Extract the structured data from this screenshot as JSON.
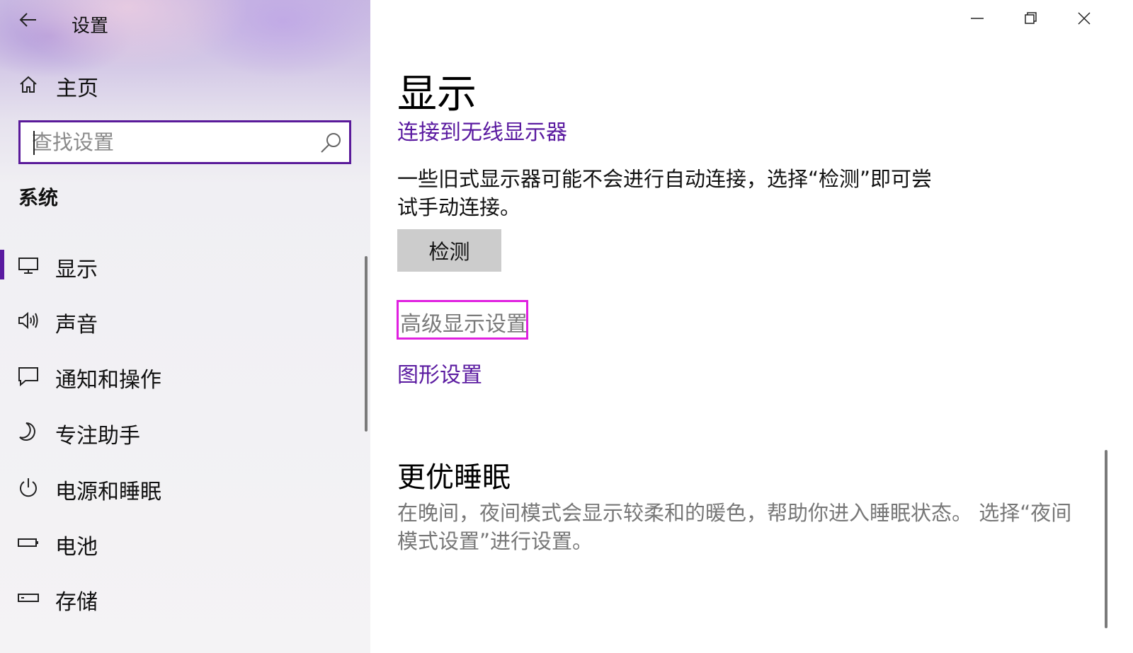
{
  "window": {
    "title": "设置",
    "controls": {
      "minimize": "minimize",
      "maximize": "restore",
      "close": "close"
    }
  },
  "sidebar": {
    "home_label": "主页",
    "search": {
      "placeholder": "查找设置",
      "value": ""
    },
    "section_title": "系统",
    "items": [
      {
        "label": "显示",
        "icon": "monitor-icon",
        "selected": true
      },
      {
        "label": "声音",
        "icon": "speaker-icon",
        "selected": false
      },
      {
        "label": "通知和操作",
        "icon": "notification-icon",
        "selected": false
      },
      {
        "label": "专注助手",
        "icon": "moon-icon",
        "selected": false
      },
      {
        "label": "电源和睡眠",
        "icon": "power-icon",
        "selected": false
      },
      {
        "label": "电池",
        "icon": "battery-icon",
        "selected": false
      },
      {
        "label": "存储",
        "icon": "storage-icon",
        "selected": false
      }
    ]
  },
  "main": {
    "page_title": "显示",
    "wireless_link": "连接到无线显示器",
    "detect_description": "一些旧式显示器可能不会进行自动连接，选择“检测”即可尝试手动连接。",
    "detect_button": "检测",
    "advanced_link": "高级显示设置",
    "graphics_link": "图形设置",
    "sleep_heading": "更优睡眠",
    "sleep_description": "在晚间，夜间模式会显示较柔和的暖色，帮助你进入睡眠状态。 选择“夜间模式设置”进行设置。"
  },
  "colors": {
    "accent": "#5a1aa0",
    "highlight_border": "#e020e0",
    "button_bg": "#cccccc"
  }
}
